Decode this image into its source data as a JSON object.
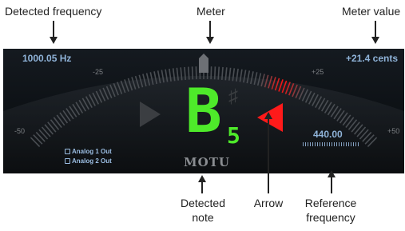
{
  "callouts": {
    "detected_frequency": "Detected frequency",
    "meter": "Meter",
    "meter_value": "Meter value",
    "detected_note_line1": "Detected",
    "detected_note_line2": "note",
    "arrow": "Arrow",
    "reference_frequency_line1": "Reference",
    "reference_frequency_line2": "frequency"
  },
  "tuner": {
    "frequency": "1000.05 Hz",
    "meter_value": "+21.4 cents",
    "scale_labels": {
      "m50": "-50",
      "m25": "-25",
      "p25": "+25",
      "p50": "+50"
    },
    "note": "B",
    "octave": "5",
    "sharp_symbol": "♯",
    "outputs": [
      "Analog 1 Out",
      "Analog 2 Out"
    ],
    "reference_frequency": "440.00",
    "logo": "MOTU",
    "meter_cents": 21.4
  },
  "colors": {
    "note_green": "#4eea2a",
    "active_arrow_red": "#ff1a1a",
    "inactive_arrow_gray": "#3b3e42",
    "readout_blue": "#8fb3d8"
  }
}
